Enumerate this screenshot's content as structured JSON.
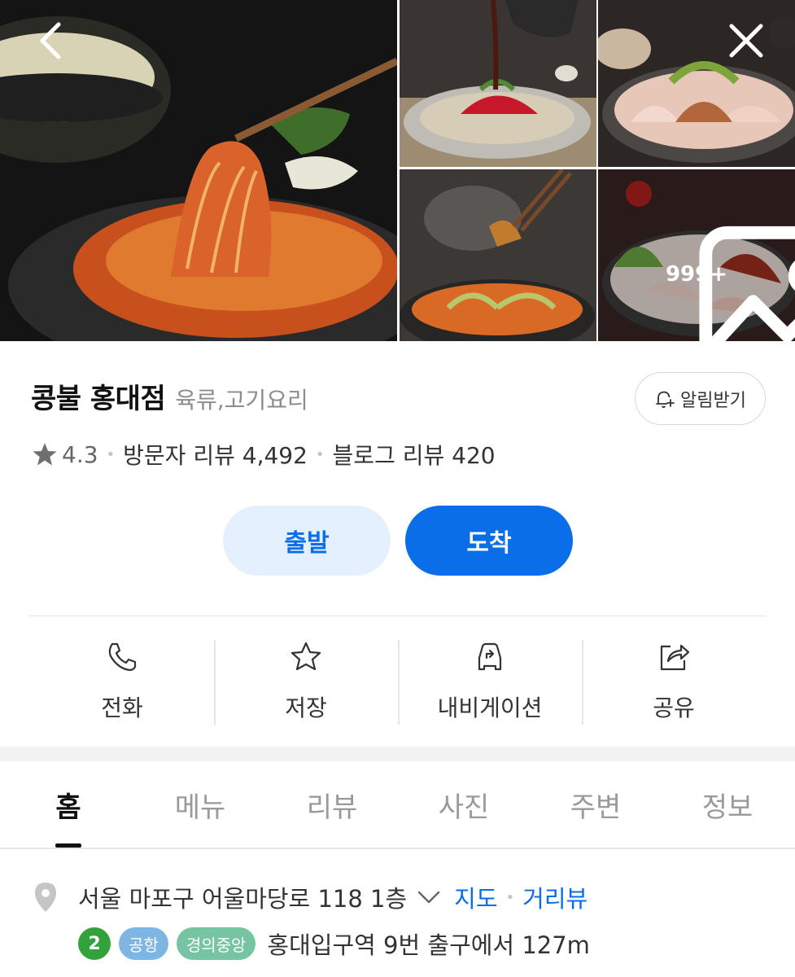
{
  "gallery": {
    "photo_count_label": "999+",
    "icons": {
      "back": "chevron-left-icon",
      "close": "close-icon",
      "photos": "image-icon"
    }
  },
  "place": {
    "name": "콩불 홍대점",
    "category": "육류,고기요리",
    "alarm_label": "알림받기",
    "rating": "4.3",
    "visitor_reviews": "방문자 리뷰 4,492",
    "blog_reviews": "블로그 리뷰 420"
  },
  "route": {
    "depart": "출발",
    "arrive": "도착"
  },
  "actions": {
    "call": "전화",
    "save": "저장",
    "navigation": "내비게이션",
    "share": "공유"
  },
  "tabs": [
    "홈",
    "메뉴",
    "리뷰",
    "사진",
    "주변",
    "정보"
  ],
  "active_tab": "홈",
  "address": {
    "text": "서울 마포구 어울마당로 118 1층",
    "map_link": "지도",
    "streetview_link": "거리뷰"
  },
  "subway": {
    "line_number": "2",
    "line_tags": [
      "공항",
      "경의중앙"
    ],
    "exit_text": "홍대입구역 9번 출구에서 127m"
  },
  "colors": {
    "accent_blue": "#0a6ee8",
    "depart_bg": "#e4f0fd",
    "line2_green": "#33a23d",
    "airport_blue": "#7db5e3",
    "gyeongui_teal": "#77c4a3"
  }
}
